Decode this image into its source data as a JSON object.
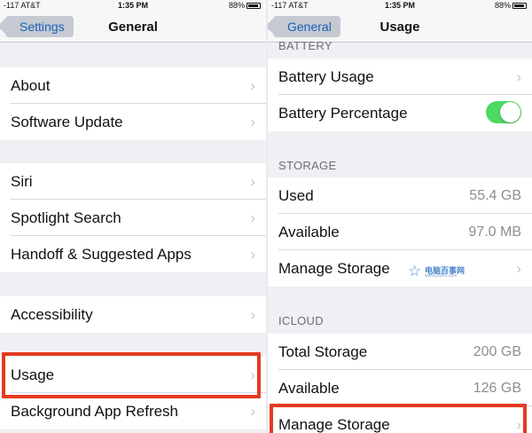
{
  "left": {
    "status": {
      "carrier": "-117 AT&T",
      "time": "1:35 PM",
      "battery": "88%"
    },
    "nav": {
      "back": "Settings",
      "title": "General"
    },
    "rows": {
      "about": "About",
      "software_update": "Software Update",
      "siri": "Siri",
      "spotlight": "Spotlight Search",
      "handoff": "Handoff & Suggested Apps",
      "accessibility": "Accessibility",
      "usage": "Usage",
      "background_refresh": "Background App Refresh"
    }
  },
  "right": {
    "status": {
      "carrier": "-117 AT&T",
      "time": "1:35 PM",
      "battery": "88%"
    },
    "nav": {
      "back": "General",
      "title": "Usage"
    },
    "battery_section": {
      "header": "BATTERY",
      "battery_usage": "Battery Usage",
      "battery_percentage": "Battery Percentage",
      "battery_percentage_on": true
    },
    "storage_section": {
      "header": "STORAGE",
      "used_label": "Used",
      "used_value": "55.4 GB",
      "available_label": "Available",
      "available_value": "97.0 MB",
      "manage_label": "Manage Storage"
    },
    "icloud_section": {
      "header": "ICLOUD",
      "total_label": "Total Storage",
      "total_value": "200 GB",
      "available_label": "Available",
      "available_value": "126 GB",
      "manage_label": "Manage Storage"
    },
    "watermark": {
      "text": "电脑百事网",
      "url": "www.pc841.com"
    }
  },
  "colors": {
    "highlight": "#e43a21",
    "toggle_on": "#4cd964",
    "link": "#1a5fb4"
  }
}
